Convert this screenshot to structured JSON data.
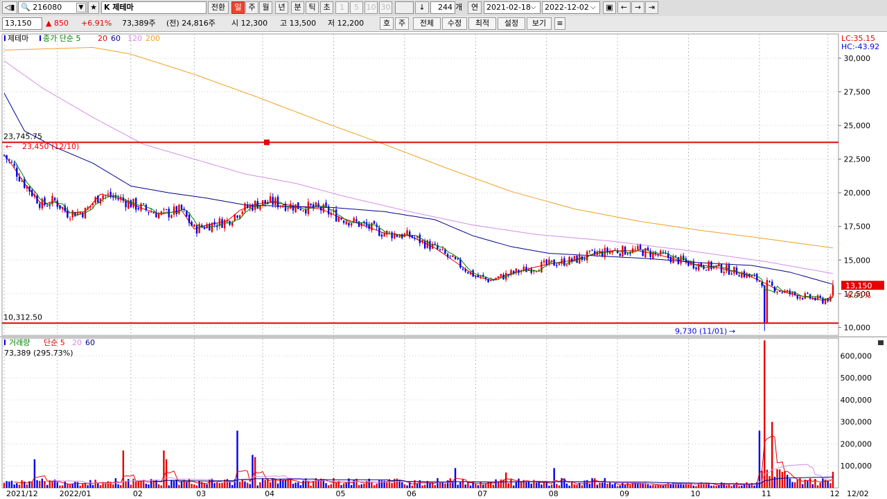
{
  "toolbar": {
    "code": "216080",
    "name": "K 제테마",
    "convert": "전환",
    "periods": [
      "일",
      "주",
      "월",
      "년",
      "분",
      "틱",
      "초"
    ],
    "active_period": "일",
    "minute_options": [
      "1",
      "5",
      "10",
      "30"
    ],
    "count": "244",
    "count_unit": "개",
    "year_label": "연",
    "date_from": "2021-02-18",
    "date_to": "2022-12-02"
  },
  "quote": {
    "price": "13,150",
    "change": "▲ 850",
    "change_pct": "+6.91%",
    "volume": "73,389주",
    "prev_volume": "(전) 24,816주",
    "open": "시 12,300",
    "high": "고 13,500",
    "low": "저 12,200",
    "buttons": [
      "호",
      "주",
      "전체",
      "수정",
      "최적",
      "설정",
      "보기"
    ]
  },
  "colors": {
    "up": "#e60000",
    "down": "#0000e6",
    "ma5": "#008000",
    "ma20": "#e60000",
    "ma60": "#00008b",
    "ma120": "#d58ce8",
    "ma200": "#f0a020",
    "hline": "#e60000"
  },
  "chart_data": [
    {
      "type": "candlestick",
      "title": "제테마",
      "legend": [
        {
          "name": "제테마"
        },
        {
          "name": "종가 단순 5"
        },
        {
          "name": "20"
        },
        {
          "name": "60"
        },
        {
          "name": "120"
        },
        {
          "name": "200"
        }
      ],
      "lc": "LC:35.15",
      "hc": "HC:-43.92",
      "ylim": [
        9400,
        31800
      ],
      "yticks": [
        {
          "v": 30000,
          "label": "30,000"
        },
        {
          "v": 27500,
          "label": "27,500"
        },
        {
          "v": 25000,
          "label": "25,000"
        },
        {
          "v": 22500,
          "label": "22,500"
        },
        {
          "v": 20000,
          "label": "20,000"
        },
        {
          "v": 17500,
          "label": "17,500"
        },
        {
          "v": 15000,
          "label": "15,000"
        },
        {
          "v": 12500,
          "label": "12,500"
        },
        {
          "v": 10000,
          "label": "10,000"
        }
      ],
      "hlines": [
        {
          "value": 23745.75,
          "label": "23,745.75"
        },
        {
          "value": 10312.5,
          "label": "10,312.50"
        }
      ],
      "annotations": [
        {
          "text": "23,450 (12/10)",
          "value": 23450
        },
        {
          "text": "9,730 (11/01)",
          "value": 9730
        }
      ],
      "last_price": "13,150",
      "last_pct": "6.91%",
      "moving_averages": {
        "ma20": [
          [
            0,
            22800
          ],
          [
            3,
            22100
          ],
          [
            8,
            20700
          ],
          [
            15,
            19100
          ],
          [
            20,
            19400
          ],
          [
            25,
            18500
          ],
          [
            32,
            18600
          ],
          [
            38,
            19900
          ],
          [
            45,
            19600
          ],
          [
            55,
            18800
          ],
          [
            62,
            18400
          ],
          [
            70,
            18700
          ],
          [
            75,
            17300
          ],
          [
            80,
            17600
          ],
          [
            88,
            17900
          ],
          [
            93,
            18700
          ],
          [
            100,
            19200
          ],
          [
            106,
            19300
          ],
          [
            115,
            19000
          ],
          [
            125,
            18800
          ],
          [
            132,
            18200
          ],
          [
            140,
            17700
          ],
          [
            150,
            17000
          ],
          [
            160,
            16800
          ],
          [
            170,
            15900
          ],
          [
            180,
            14600
          ],
          [
            186,
            13800
          ],
          [
            192,
            13500
          ],
          [
            200,
            14000
          ],
          [
            210,
            14500
          ],
          [
            218,
            14800
          ],
          [
            225,
            15000
          ],
          [
            232,
            15400
          ],
          [
            240,
            15700
          ],
          [
            250,
            15700
          ],
          [
            258,
            15400
          ],
          [
            266,
            15000
          ],
          [
            272,
            14700
          ],
          [
            280,
            14500
          ],
          [
            290,
            14100
          ],
          [
            298,
            13500
          ],
          [
            305,
            12800
          ],
          [
            310,
            12500
          ],
          [
            318,
            12200
          ],
          [
            323,
            12000
          ],
          [
            327,
            12300
          ]
        ],
        "ma60": [
          [
            0,
            27400
          ],
          [
            8,
            24600
          ],
          [
            20,
            23400
          ],
          [
            35,
            22200
          ],
          [
            50,
            20500
          ],
          [
            65,
            20000
          ],
          [
            80,
            19600
          ],
          [
            95,
            19100
          ],
          [
            110,
            19000
          ],
          [
            130,
            18900
          ],
          [
            150,
            18600
          ],
          [
            170,
            18000
          ],
          [
            185,
            16800
          ],
          [
            200,
            16000
          ],
          [
            215,
            15500
          ],
          [
            235,
            15300
          ],
          [
            255,
            15100
          ],
          [
            275,
            14800
          ],
          [
            295,
            14600
          ],
          [
            310,
            14100
          ],
          [
            327,
            13200
          ]
        ],
        "ma120": [
          [
            0,
            29800
          ],
          [
            15,
            27800
          ],
          [
            35,
            25600
          ],
          [
            55,
            23600
          ],
          [
            75,
            22500
          ],
          [
            95,
            21400
          ],
          [
            115,
            20700
          ],
          [
            135,
            19700
          ],
          [
            160,
            18600
          ],
          [
            185,
            17600
          ],
          [
            210,
            16900
          ],
          [
            240,
            16400
          ],
          [
            270,
            15700
          ],
          [
            300,
            14900
          ],
          [
            327,
            14000
          ]
        ],
        "ma200": [
          [
            0,
            30600
          ],
          [
            35,
            30800
          ],
          [
            50,
            30300
          ],
          [
            75,
            28800
          ],
          [
            100,
            27100
          ],
          [
            125,
            25300
          ],
          [
            150,
            23600
          ],
          [
            175,
            21800
          ],
          [
            200,
            20100
          ],
          [
            225,
            18800
          ],
          [
            250,
            17900
          ],
          [
            275,
            17200
          ],
          [
            300,
            16600
          ],
          [
            327,
            15900
          ]
        ]
      }
    },
    {
      "type": "bar",
      "title": "거래량",
      "legend": [
        {
          "name": "거래량"
        },
        {
          "name": "단순 5"
        },
        {
          "name": "20"
        },
        {
          "name": "60"
        }
      ],
      "volume_label": "73,389 (295.73%)",
      "ylim": [
        0,
        680000
      ],
      "yticks": [
        {
          "v": 600000,
          "label": "600,000"
        },
        {
          "v": 500000,
          "label": "500,000"
        },
        {
          "v": 400000,
          "label": "400,000"
        },
        {
          "v": 300000,
          "label": "300,000"
        },
        {
          "v": 200000,
          "label": "200,000"
        },
        {
          "v": 100000,
          "label": "100,000"
        }
      ],
      "peaks": [
        {
          "i": 12,
          "v": 130000
        },
        {
          "i": 47,
          "v": 170000
        },
        {
          "i": 63,
          "v": 170000
        },
        {
          "i": 64,
          "v": 130000
        },
        {
          "i": 92,
          "v": 260000
        },
        {
          "i": 98,
          "v": 150000
        },
        {
          "i": 99,
          "v": 140000
        },
        {
          "i": 178,
          "v": 90000
        },
        {
          "i": 198,
          "v": 70000
        },
        {
          "i": 217,
          "v": 90000
        },
        {
          "i": 298,
          "v": 260000
        },
        {
          "i": 300,
          "v": 670000
        },
        {
          "i": 303,
          "v": 300000
        },
        {
          "i": 327,
          "v": 73389
        }
      ]
    }
  ],
  "time_axis": [
    {
      "label": "2021/12",
      "x": 0
    },
    {
      "label": "2022/01",
      "x": 21
    },
    {
      "label": "02",
      "x": 50
    },
    {
      "label": "03",
      "x": 75
    },
    {
      "label": "04",
      "x": 102
    },
    {
      "label": "05",
      "x": 130
    },
    {
      "label": "06",
      "x": 158
    },
    {
      "label": "07",
      "x": 186
    },
    {
      "label": "08",
      "x": 214
    },
    {
      "label": "09",
      "x": 242
    },
    {
      "label": "10",
      "x": 270
    },
    {
      "label": "11",
      "x": 298
    },
    {
      "label": "12",
      "x": 325
    }
  ],
  "time_axis_right": "12/02"
}
